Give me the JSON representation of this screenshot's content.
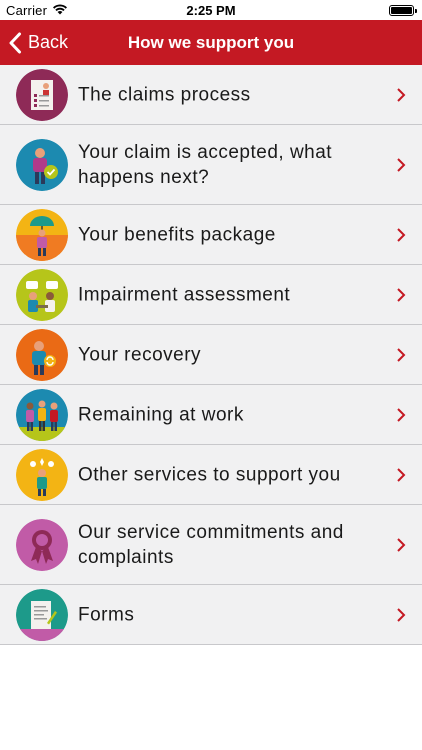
{
  "status_bar": {
    "carrier": "Carrier",
    "time": "2:25 PM"
  },
  "nav": {
    "back_label": "Back",
    "title": "How we support you",
    "bar_color": "#c41923"
  },
  "menu": {
    "items": [
      {
        "label": "The claims process",
        "icon": "clipboard-checklist-icon",
        "color": "#8e2a57"
      },
      {
        "label": "Your claim is accepted, what happens next?",
        "icon": "person-checkmark-icon",
        "color": "#1c8ab0"
      },
      {
        "label": "Your benefits package",
        "icon": "person-umbrella-icon",
        "color": "#f07b22"
      },
      {
        "label": "Impairment assessment",
        "icon": "people-discussion-icon",
        "color": "#b6c51a"
      },
      {
        "label": "Your recovery",
        "icon": "person-recovery-icon",
        "color": "#ea6a15"
      },
      {
        "label": "Remaining at work",
        "icon": "coworkers-group-icon",
        "color": "#1c8ab0"
      },
      {
        "label": "Other services to support you",
        "icon": "support-services-icon",
        "color": "#f3b414"
      },
      {
        "label": "Our service commitments and complaints",
        "icon": "award-ribbon-icon",
        "color": "#c15ba7"
      },
      {
        "label": "Forms",
        "icon": "form-document-icon",
        "color": "#1d9a8a"
      }
    ],
    "chevron_color": "#c41923"
  }
}
